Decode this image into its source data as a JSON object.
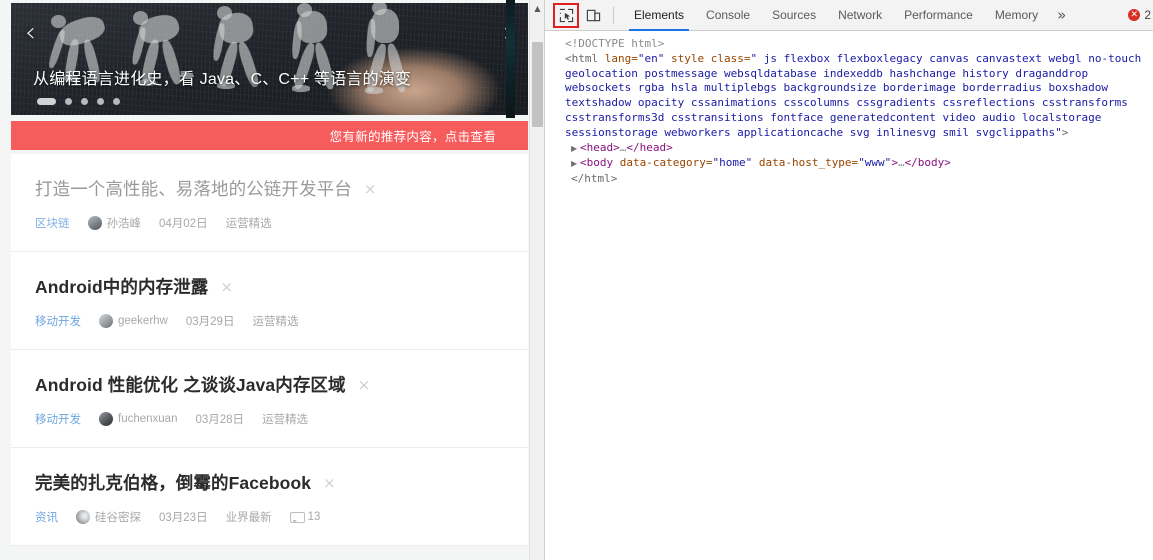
{
  "browser": {
    "carousel": {
      "title": "从编程语言进化史，看 Java、C、C++ 等语言的演变",
      "prev_arrow": "‹",
      "next_arrow": "›",
      "dot_count": 5,
      "active_dot_index": 0
    },
    "notification": {
      "text": "您有新的推荐内容，点击查看",
      "background_color": "#f75c5c"
    },
    "articles": [
      {
        "title": "打造一个高性能、易落地的公链开发平台",
        "close": "×",
        "category": "区块链",
        "author": "孙浩峰",
        "date": "04月02日",
        "tag": "运营精选",
        "comments": "",
        "visited": true
      },
      {
        "title": "Android中的内存泄露",
        "close": "×",
        "category": "移动开发",
        "author": "geekerhw",
        "date": "03月29日",
        "tag": "运营精选",
        "comments": "",
        "visited": false
      },
      {
        "title": "Android 性能优化 之谈谈Java内存区域",
        "close": "×",
        "category": "移动开发",
        "author": "fuchenxuan",
        "date": "03月28日",
        "tag": "运营精选",
        "comments": "",
        "visited": false
      },
      {
        "title": "完美的扎克伯格，倒霉的Facebook",
        "close": "×",
        "category": "资讯",
        "author": "硅谷密探",
        "date": "03月23日",
        "tag": "业界最新",
        "comments": "13",
        "visited": false
      }
    ],
    "scrollbar": {
      "up_arrow": "▲"
    }
  },
  "devtools": {
    "toolbar": {
      "inspect_tooltip": "Select an element in the page to inspect it",
      "device_toolbar_tooltip": "Toggle device toolbar",
      "more_tabs": "»",
      "error_count": "2",
      "error_glyph": "✕"
    },
    "tabs": [
      {
        "label": "Elements",
        "active": true
      },
      {
        "label": "Console",
        "active": false
      },
      {
        "label": "Sources",
        "active": false
      },
      {
        "label": "Network",
        "active": false
      },
      {
        "label": "Performance",
        "active": false
      },
      {
        "label": "Memory",
        "active": false
      }
    ],
    "dom": {
      "doctype": "<!DOCTYPE html>",
      "html_open_prefix": "<html ",
      "attr_lang_name": "lang=",
      "attr_lang_value": "\"en\"",
      "attr_style_name": "style",
      "attr_class_name": " class=",
      "attr_class_value": "\" js flexbox flexboxlegacy canvas canvastext webgl no-touch geolocation postmessage websqldatabase indexeddb hashchange history draganddrop websockets rgba hsla multiplebgs backgroundsize borderimage borderradius boxshadow textshadow opacity cssanimations csscolumns cssgradients cssreflections csstransforms csstransforms3d csstransitions fontface generatedcontent video audio localstorage sessionstorage webworkers applicationcache svg inlinesvg smil svgclippaths\"",
      "html_open_suffix": ">",
      "head_triangle": "▶",
      "head_open": "<head>",
      "head_ellipsis": "…",
      "head_close": "</head>",
      "body_triangle": "▶",
      "body_open_prefix": "<body ",
      "body_attr1_name": "data-category=",
      "body_attr1_value": "\"home\"",
      "body_attr2_name": " data-host_type=",
      "body_attr2_value": "\"www\"",
      "body_open_suffix": ">",
      "body_ellipsis": "…",
      "body_close": "</body>",
      "html_close": "</html>"
    }
  }
}
